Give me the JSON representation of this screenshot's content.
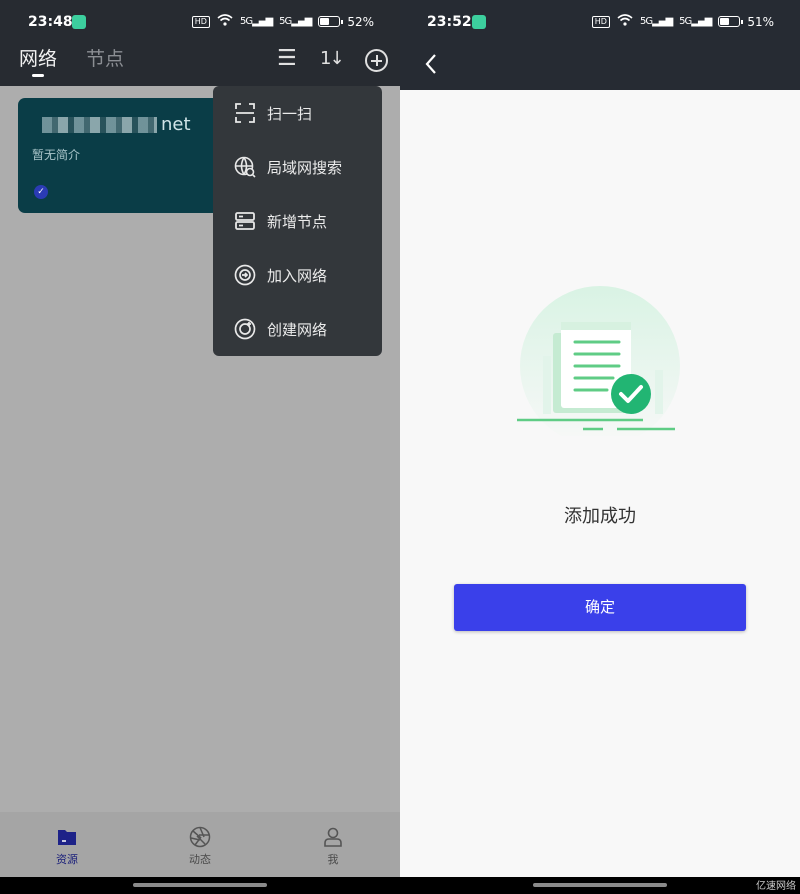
{
  "left": {
    "status": {
      "time": "23:48",
      "battery": "52%",
      "battery_level": 0.52
    },
    "tabs": [
      {
        "label": "网络"
      },
      {
        "label": "节点"
      }
    ],
    "card": {
      "name_suffix": "net",
      "description": "暂无简介"
    },
    "menu": {
      "items": [
        {
          "label": "扫一扫",
          "icon": "scan-icon"
        },
        {
          "label": "局域网搜索",
          "icon": "lan-search-icon"
        },
        {
          "label": "新增节点",
          "icon": "server-icon"
        },
        {
          "label": "加入网络",
          "icon": "join-network-icon"
        },
        {
          "label": "创建网络",
          "icon": "create-network-icon"
        }
      ]
    },
    "bottom_nav": [
      {
        "label": "资源",
        "icon": "folder-icon"
      },
      {
        "label": "动态",
        "icon": "aperture-icon"
      },
      {
        "label": "我",
        "icon": "user-icon"
      }
    ]
  },
  "right": {
    "status": {
      "time": "23:52",
      "battery": "51%",
      "battery_level": 0.51
    },
    "message": "添加成功",
    "confirm_label": "确定",
    "colors": {
      "accent": "#3a40ea",
      "success": "#22b573"
    }
  },
  "watermark": "亿速网络"
}
